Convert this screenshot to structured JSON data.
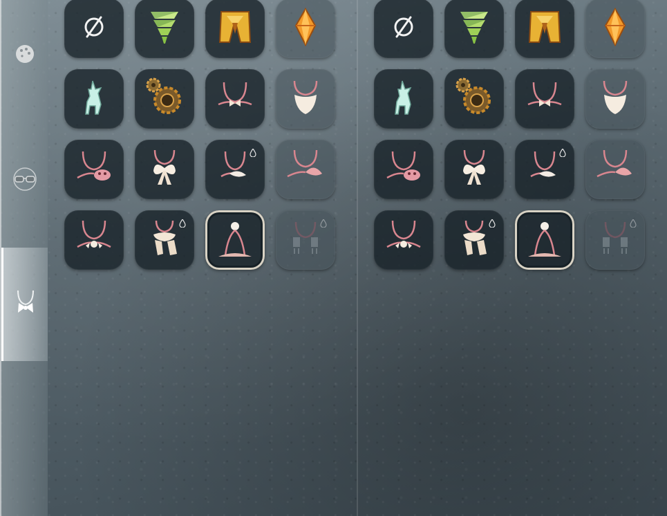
{
  "sidebar": {
    "tabs": [
      {
        "name": "face-paint-tab",
        "icon": "palette-icon"
      },
      {
        "name": "glasses-tab",
        "icon": "glasses-icon"
      },
      {
        "name": "neck-accessory-tab",
        "icon": "necklace-bow-icon",
        "active": true
      }
    ]
  },
  "panels": [
    {
      "name": "left-panel",
      "items": [
        {
          "icon": "none-icon"
        },
        {
          "icon": "tornado-icon"
        },
        {
          "icon": "golden-cape-icon"
        },
        {
          "icon": "orange-crystal-icon"
        },
        {
          "icon": "spirit-deer-icon"
        },
        {
          "icon": "bronze-gear-icon"
        },
        {
          "icon": "bow-necklace-icon"
        },
        {
          "icon": "beard-necklace-icon"
        },
        {
          "icon": "pink-frog-necklace-icon"
        },
        {
          "icon": "large-bow-necklace-icon"
        },
        {
          "icon": "shell-necklace-icon",
          "droplet": true
        },
        {
          "icon": "crab-necklace-icon"
        },
        {
          "icon": "flower-necklace-icon"
        },
        {
          "icon": "scarf-necklace-icon",
          "droplet": true
        },
        {
          "icon": "long-cord-pendant-icon",
          "selected": true
        },
        {
          "icon": "tassel-necklace-icon",
          "droplet": true,
          "dim": true
        }
      ]
    },
    {
      "name": "right-panel",
      "items": [
        {
          "icon": "none-icon"
        },
        {
          "icon": "tornado-icon"
        },
        {
          "icon": "golden-cape-icon"
        },
        {
          "icon": "orange-crystal-icon"
        },
        {
          "icon": "spirit-deer-icon"
        },
        {
          "icon": "bronze-gear-icon"
        },
        {
          "icon": "bow-necklace-icon"
        },
        {
          "icon": "beard-necklace-icon"
        },
        {
          "icon": "pink-frog-necklace-icon"
        },
        {
          "icon": "large-bow-necklace-icon"
        },
        {
          "icon": "shell-necklace-icon",
          "droplet": true
        },
        {
          "icon": "crab-necklace-icon"
        },
        {
          "icon": "flower-necklace-icon"
        },
        {
          "icon": "scarf-necklace-icon",
          "droplet": true
        },
        {
          "icon": "long-cord-pendant-icon",
          "selected": true
        },
        {
          "icon": "tassel-necklace-icon",
          "droplet": true,
          "dim": true
        }
      ]
    }
  ],
  "colors": {
    "slot_bg": "#16202a",
    "cord_pink": "#d9868f",
    "cream": "#f3e6d6",
    "gold": "#e3a93a",
    "selected_border": "#d8d2c4"
  }
}
